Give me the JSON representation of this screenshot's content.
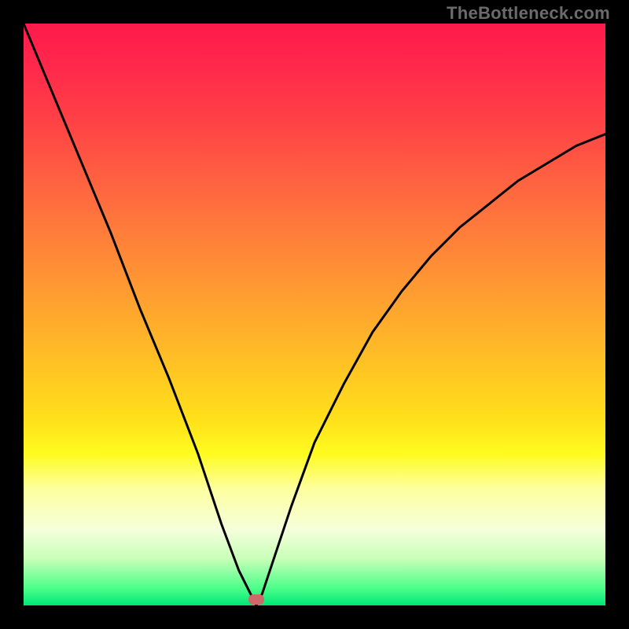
{
  "attribution": "TheBottleneck.com",
  "colors": {
    "frame": "#000000",
    "gradient_top": "#ff1a4b",
    "gradient_bottom": "#00e676",
    "curve": "#000000",
    "marker": "#cc6a6a",
    "attribution_text": "#6b6b6b"
  },
  "chart_data": {
    "type": "line",
    "title": "",
    "xlabel": "",
    "ylabel": "",
    "xlim": [
      0,
      1
    ],
    "ylim": [
      0,
      1
    ],
    "annotations": [
      "TheBottleneck.com"
    ],
    "x": [
      0.0,
      0.05,
      0.1,
      0.15,
      0.2,
      0.25,
      0.3,
      0.34,
      0.37,
      0.39,
      0.4,
      0.41,
      0.43,
      0.46,
      0.5,
      0.55,
      0.6,
      0.65,
      0.7,
      0.75,
      0.8,
      0.85,
      0.9,
      0.95,
      1.0
    ],
    "values": [
      1.0,
      0.88,
      0.76,
      0.64,
      0.51,
      0.39,
      0.26,
      0.14,
      0.06,
      0.02,
      0.0,
      0.02,
      0.08,
      0.17,
      0.28,
      0.38,
      0.47,
      0.54,
      0.6,
      0.65,
      0.69,
      0.73,
      0.76,
      0.79,
      0.81
    ],
    "marker": {
      "x": 0.4,
      "y": 0.005
    },
    "grid": false,
    "notes": "V-shaped bottleneck curve over a vertical red→yellow→green gradient inside a black frame. x and y are normalized to the plot area (0 = left/bottom, 1 = right/top)."
  }
}
